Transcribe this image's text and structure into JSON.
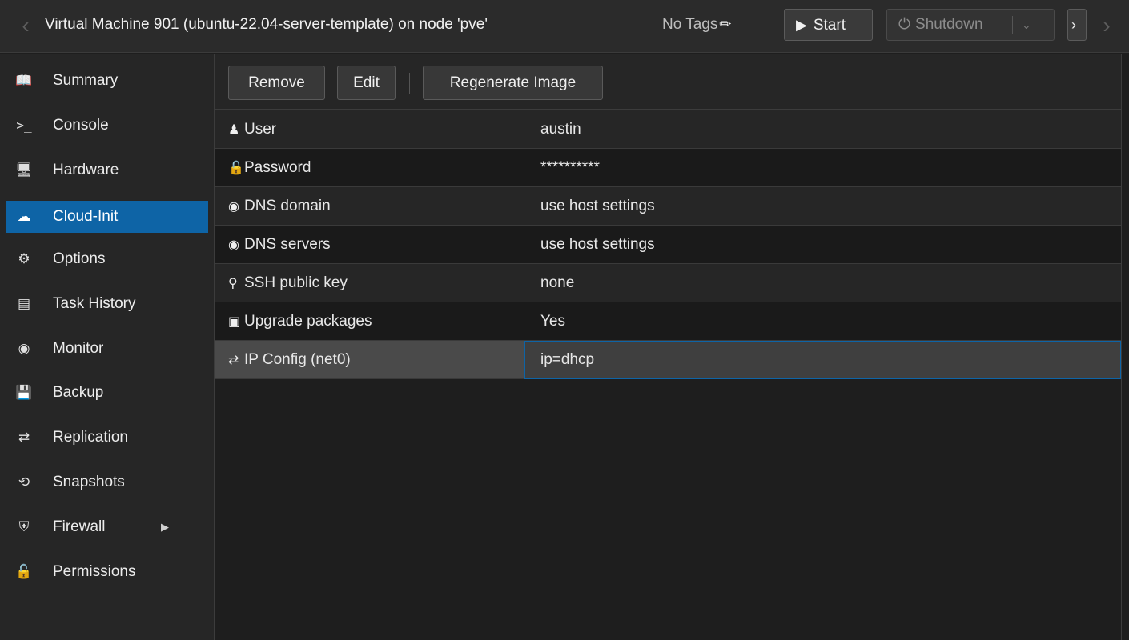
{
  "titlebar": {
    "title": "Virtual Machine 901 (ubuntu-22.04-server-template) on node 'pve'",
    "tags_label": "No Tags",
    "start_label": "Start",
    "shutdown_label": "Shutdown"
  },
  "sidebar": {
    "items": [
      {
        "label": "Summary",
        "icon": "book-icon"
      },
      {
        "label": "Console",
        "icon": "terminal-icon"
      },
      {
        "label": "Hardware",
        "icon": "monitor-icon"
      },
      {
        "label": "Cloud-Init",
        "icon": "cloud-icon",
        "active": true
      },
      {
        "label": "Options",
        "icon": "gear-icon"
      },
      {
        "label": "Task History",
        "icon": "list-icon"
      },
      {
        "label": "Monitor",
        "icon": "eye-icon"
      },
      {
        "label": "Backup",
        "icon": "floppy-icon"
      },
      {
        "label": "Replication",
        "icon": "retweet-icon"
      },
      {
        "label": "Snapshots",
        "icon": "history-icon"
      },
      {
        "label": "Firewall",
        "icon": "shield-icon"
      },
      {
        "label": "Permissions",
        "icon": "unlock-icon"
      }
    ]
  },
  "toolbar": {
    "remove_label": "Remove",
    "edit_label": "Edit",
    "regenerate_label": "Regenerate Image"
  },
  "rows": [
    {
      "key": "User",
      "value": "austin",
      "icon": "user-icon"
    },
    {
      "key": "Password",
      "value": "**********",
      "icon": "unlock-icon"
    },
    {
      "key": "DNS domain",
      "value": "use host settings",
      "icon": "globe-icon"
    },
    {
      "key": "DNS servers",
      "value": "use host settings",
      "icon": "globe-icon"
    },
    {
      "key": "SSH public key",
      "value": "none",
      "icon": "key-icon"
    },
    {
      "key": "Upgrade packages",
      "value": "Yes",
      "icon": "archive-icon"
    },
    {
      "key": "IP Config (net0)",
      "value": "ip=dhcp",
      "icon": "exchange-icon",
      "selected": true
    }
  ],
  "colors": {
    "accent": "#0e64a6",
    "background": "#1e1e1e",
    "panel": "#262626"
  }
}
